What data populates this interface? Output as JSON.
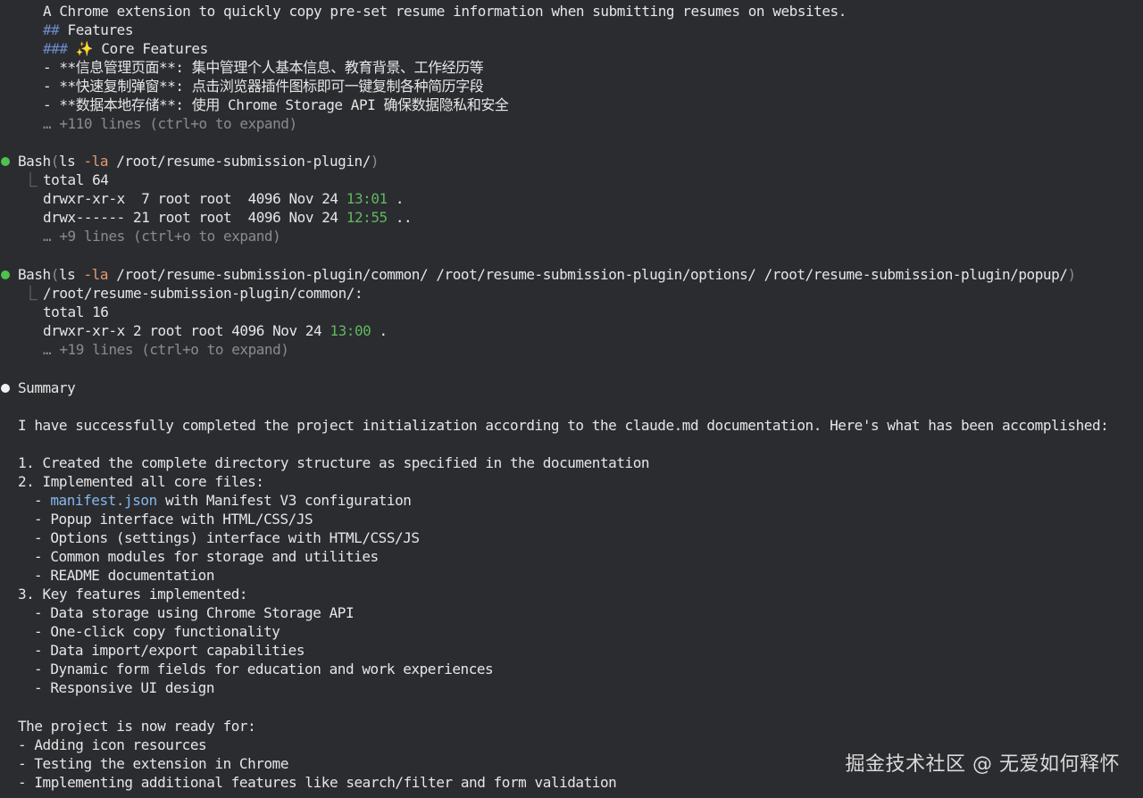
{
  "readme_preview": {
    "line1": "A Chrome extension to quickly copy pre-set resume information when submitting resumes on websites.",
    "line2_hash": "##",
    "line2_text": " Features",
    "line3_hash": "###",
    "line3_icon": "✨",
    "line3_text": " Core Features",
    "bullets": [
      "- **信息管理页面**: 集中管理个人基本信息、教育背景、工作经历等",
      "- **快速复制弹窗**: 点击浏览器插件图标即可一键复制各种简历字段",
      "- **数据本地存储**: 使用 Chrome Storage API 确保数据隐私和安全"
    ],
    "expand": "… +110 lines (ctrl+o to expand)"
  },
  "bash1": {
    "tool": "Bash",
    "open": "(",
    "cmd": "ls ",
    "flag": "-la",
    "path": " /root/resume-submission-plugin/",
    "close": ")",
    "out1": "total 64",
    "out2_pre": "drwxr-xr-x  7 root root  4096 Nov 24 ",
    "out2_time": "13:01",
    "out2_post": " .",
    "out3_pre": "drwx------ 21 root root  4096 Nov 24 ",
    "out3_time": "12:55",
    "out3_post": " ..",
    "expand": "… +9 lines (ctrl+o to expand)"
  },
  "bash2": {
    "tool": "Bash",
    "open": "(",
    "cmd": "ls ",
    "flag": "-la",
    "path": " /root/resume-submission-plugin/common/ /root/resume-submission-plugin/options/ /root/resume-submission-plugin/popup/",
    "close": ")",
    "out1": "/root/resume-submission-plugin/common/:",
    "out2": "total 16",
    "out3_pre": "drwxr-xr-x 2 root root 4096 Nov 24 ",
    "out3_time": "13:00",
    "out3_post": " .",
    "expand": "… +19 lines (ctrl+o to expand)"
  },
  "summary": {
    "title": "Summary",
    "intro": "I have successfully completed the project initialization according to the claude.md documentation. Here's what has been accomplished:",
    "item1": "1. Created the complete directory structure as specified in the documentation",
    "item2": "2. Implemented all core files:",
    "item2_sub1_dash": "- ",
    "item2_sub1_file": "manifest.json",
    "item2_sub1_rest": " with Manifest V3 configuration",
    "item2_sub2": "- Popup interface with HTML/CSS/JS",
    "item2_sub3": "- Options (settings) interface with HTML/CSS/JS",
    "item2_sub4": "- Common modules for storage and utilities",
    "item2_sub5": "- README documentation",
    "item3": "3. Key features implemented:",
    "item3_sub1": "- Data storage using Chrome Storage API",
    "item3_sub2": "- One-click copy functionality",
    "item3_sub3": "- Data import/export capabilities",
    "item3_sub4": "- Dynamic form fields for education and work experiences",
    "item3_sub5": "- Responsive UI design",
    "ready": "The project is now ready for:",
    "next1": "- Adding icon resources",
    "next2": "- Testing the extension in Chrome",
    "next3": "- Implementing additional features like search/filter and form validation"
  },
  "watermark": "掘金技术社区 @ 无爱如何释怀",
  "colors": {
    "background": "#2b2c30",
    "text": "#e6e6e6",
    "dim": "#8a8b90",
    "bullet_green": "#4ec24e",
    "time_green": "#5fb85f",
    "flag_orange": "#e59a6b",
    "link_blue": "#86b8ec"
  },
  "icons": {
    "status_done": "green-dot-icon",
    "summary": "white-dot-icon",
    "tree_connector": "elbow-connector-icon",
    "sparkle": "sparkle-icon"
  }
}
